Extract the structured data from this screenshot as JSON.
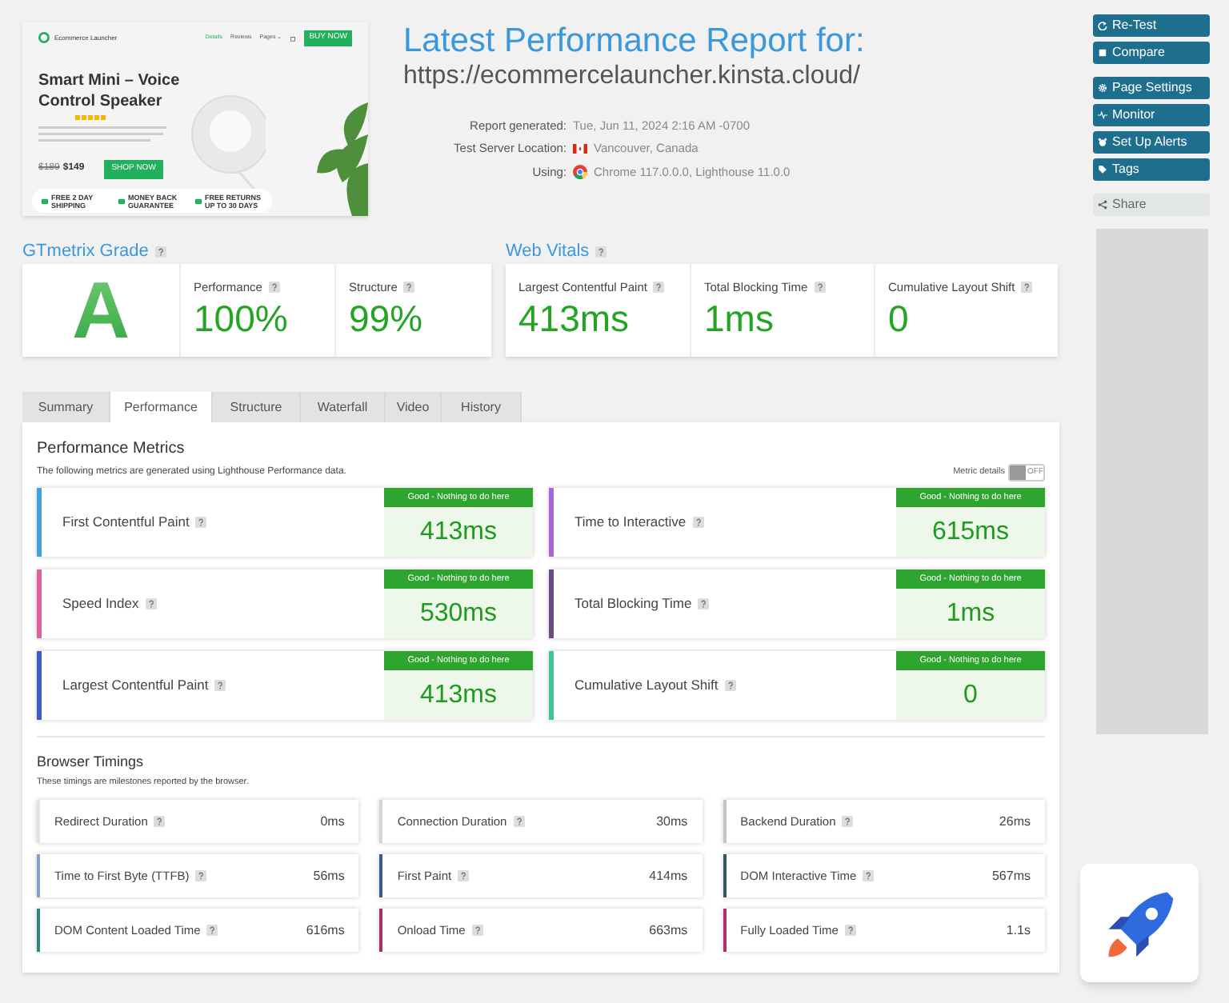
{
  "preview": {
    "brand": "Ecommerce Launcher",
    "nav": [
      {
        "label": "Details",
        "selected": true
      },
      {
        "label": "Reviews",
        "selected": false
      },
      {
        "label": "Pages ⌄",
        "selected": false
      }
    ],
    "buy_button": "BUY NOW",
    "headline": "Smart Mini – Voice Control Speaker",
    "stars": 5,
    "old_price": "$189",
    "price": "$149",
    "shop_button": "SHOP NOW",
    "features": [
      "FREE 2 DAY SHIPPING",
      "MONEY BACK GUARANTEE",
      "FREE RETURNS UP TO 30 DAYS"
    ]
  },
  "report": {
    "title": "Latest Performance Report for:",
    "url": "https://ecommercelauncher.kinsta.cloud/",
    "details": [
      {
        "label": "Report generated:",
        "value": "Tue, Jun 11, 2024 2:16 AM -0700",
        "kind": "plain"
      },
      {
        "label": "Test Server Location:",
        "value": "Vancouver, Canada",
        "kind": "flag"
      },
      {
        "label": "Using:",
        "value": "Chrome 117.0.0.0, Lighthouse 11.0.0",
        "kind": "browser"
      }
    ]
  },
  "actions": [
    {
      "label": "Re-Test",
      "kind": "refresh"
    },
    {
      "label": "Compare",
      "kind": "compare"
    },
    {
      "label": "Page Settings",
      "kind": "gear"
    },
    {
      "label": "Monitor",
      "kind": "pulse"
    },
    {
      "label": "Set Up Alerts",
      "kind": "alarm"
    },
    {
      "label": "Tags",
      "kind": "tag"
    }
  ],
  "share": "Share",
  "grade": {
    "title": "GTmetrix Grade",
    "letter": "A",
    "scores": [
      {
        "label": "Performance",
        "value": "100%"
      },
      {
        "label": "Structure",
        "value": "99%"
      }
    ]
  },
  "web_vitals": {
    "title": "Web Vitals",
    "items": [
      {
        "label": "Largest Contentful Paint",
        "value": "413ms"
      },
      {
        "label": "Total Blocking Time",
        "value": "1ms"
      },
      {
        "label": "Cumulative Layout Shift",
        "value": "0"
      }
    ]
  },
  "tabs": [
    {
      "label": "Summary",
      "selected": false
    },
    {
      "label": "Performance",
      "selected": true
    },
    {
      "label": "Structure",
      "selected": false
    },
    {
      "label": "Waterfall",
      "selected": false
    },
    {
      "label": "Video",
      "selected": false
    },
    {
      "label": "History",
      "selected": false
    }
  ],
  "performance_metrics": {
    "title": "Performance Metrics",
    "description": "The following metrics are generated using Lighthouse Performance data.",
    "toggle": {
      "label": "Metric details",
      "state": "OFF",
      "on": false
    },
    "metrics": [
      {
        "label": "First Contentful Paint",
        "badge": "Good - Nothing to do here",
        "value": "413ms",
        "color": "#3fa3dc"
      },
      {
        "label": "Time to Interactive",
        "badge": "Good - Nothing to do here",
        "value": "615ms",
        "color": "#a865d8"
      },
      {
        "label": "Speed Index",
        "badge": "Good - Nothing to do here",
        "value": "530ms",
        "color": "#e0609e"
      },
      {
        "label": "Total Blocking Time",
        "badge": "Good - Nothing to do here",
        "value": "1ms",
        "color": "#6a4b86"
      },
      {
        "label": "Largest Contentful Paint",
        "badge": "Good - Nothing to do here",
        "value": "413ms",
        "color": "#3d5cc2"
      },
      {
        "label": "Cumulative Layout Shift",
        "badge": "Good - Nothing to do here",
        "value": "0",
        "color": "#3ec49d"
      }
    ]
  },
  "browser_timings": {
    "title": "Browser Timings",
    "description": "These timings are milestones reported by the browser.",
    "items": [
      {
        "label": "Redirect Duration",
        "value": "0ms",
        "color": "#e2e2e2"
      },
      {
        "label": "Connection Duration",
        "value": "30ms",
        "color": "#d4d4d4"
      },
      {
        "label": "Backend Duration",
        "value": "26ms",
        "color": "#c4c4c4"
      },
      {
        "label": "Time to First Byte (TTFB)",
        "value": "56ms",
        "color": "#8c9bd2"
      },
      {
        "label": "First Paint",
        "value": "414ms",
        "color": "#3c5a8c"
      },
      {
        "label": "DOM Interactive Time",
        "value": "567ms",
        "color": "#2f5a60"
      },
      {
        "label": "DOM Content Loaded Time",
        "value": "616ms",
        "color": "#2b8a80"
      },
      {
        "label": "Onload Time",
        "value": "663ms",
        "color": "#a3306c"
      },
      {
        "label": "Fully Loaded Time",
        "value": "1.1s",
        "color": "#b42e6e"
      }
    ]
  }
}
